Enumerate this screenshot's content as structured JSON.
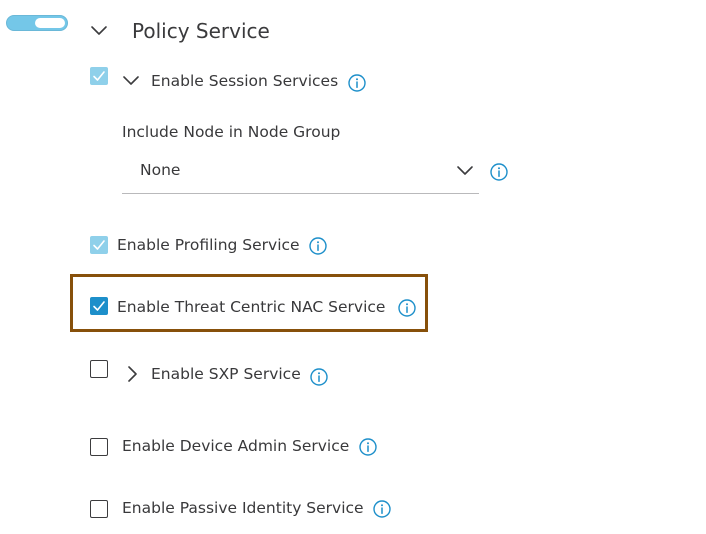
{
  "section": {
    "title": "Policy Service",
    "toggle_state": "on"
  },
  "session_services": {
    "label": "Enable Session Services",
    "checked": true,
    "disabled": true,
    "expanded": true,
    "node_group": {
      "label": "Include Node in Node Group",
      "value": "None"
    }
  },
  "profiling": {
    "label": "Enable Profiling Service",
    "checked": true,
    "disabled": true
  },
  "threat_centric": {
    "label": "Enable Threat Centric NAC Service",
    "checked": true,
    "highlighted": true
  },
  "sxp": {
    "label": "Enable SXP Service",
    "checked": false,
    "expanded": false
  },
  "device_admin": {
    "label": "Enable Device Admin Service",
    "checked": false
  },
  "passive_identity": {
    "label": "Enable Passive Identity Service",
    "checked": false
  },
  "colors": {
    "accent": "#1d8fca",
    "disabled_check": "#8fd0ea",
    "highlight_border": "#87500a",
    "toggle": "#74c7e8"
  },
  "icons": [
    "chevron-down-icon",
    "chevron-right-icon",
    "info-icon",
    "checkmark-icon"
  ]
}
